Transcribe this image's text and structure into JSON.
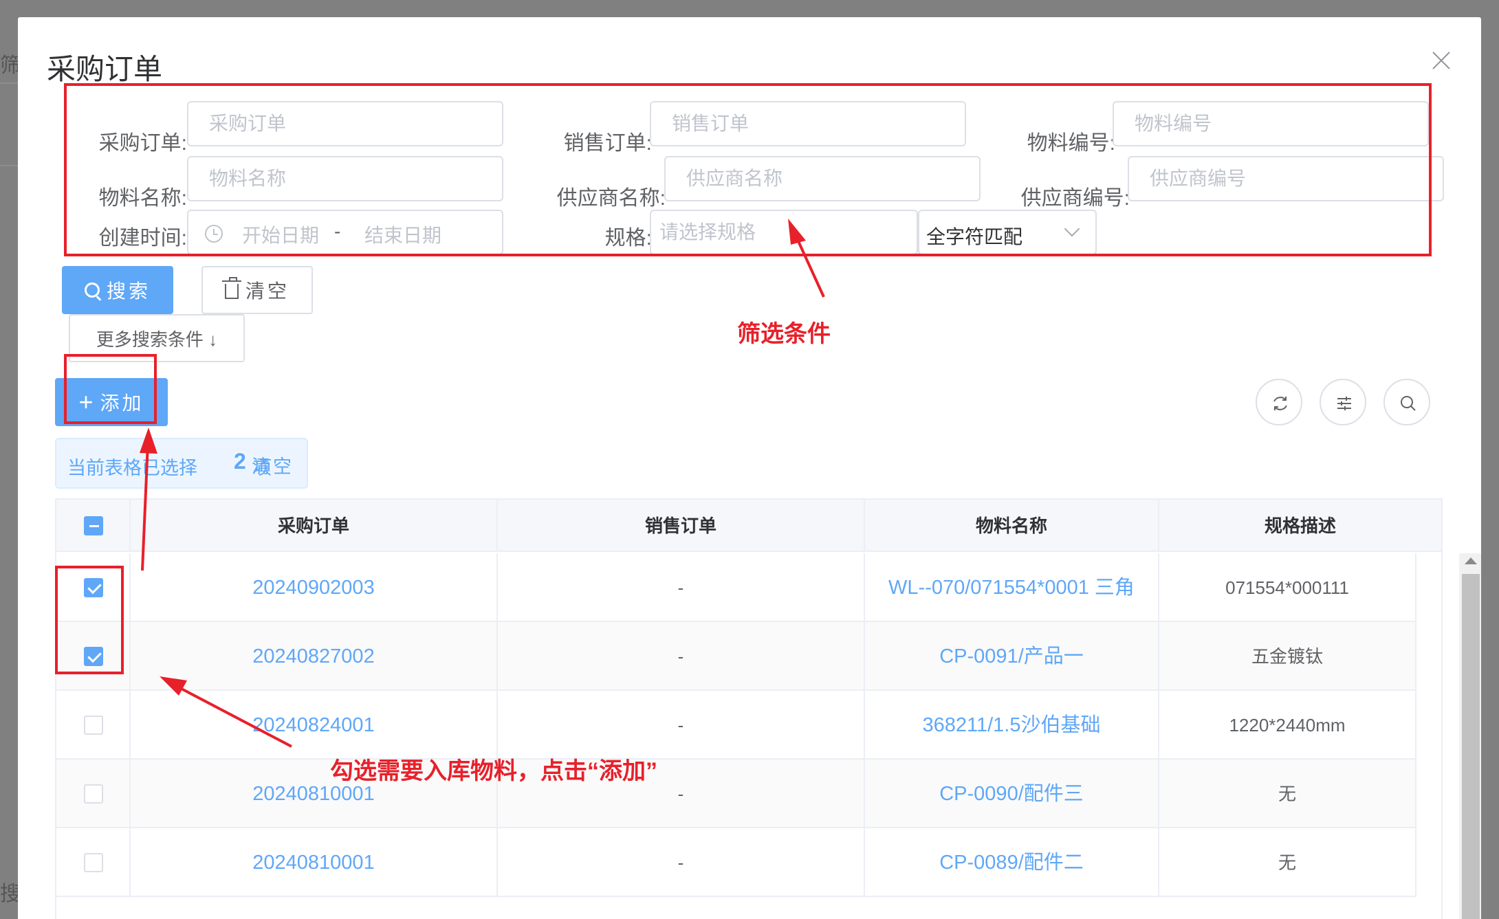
{
  "background": {
    "fragments": [
      "筛场",
      "搜"
    ]
  },
  "modal": {
    "title": "采购订单",
    "close_label": "×"
  },
  "filters": {
    "purchase_order": {
      "label": "采购订单:",
      "placeholder": "采购订单"
    },
    "sales_order": {
      "label": "销售订单:",
      "placeholder": "销售订单"
    },
    "material_code": {
      "label": "物料编号:",
      "placeholder": "物料编号"
    },
    "material_name": {
      "label": "物料名称:",
      "placeholder": "物料名称"
    },
    "supplier_name": {
      "label": "供应商名称:",
      "placeholder": "供应商名称"
    },
    "supplier_code": {
      "label": "供应商编号:",
      "placeholder": "供应商编号"
    },
    "created_time": {
      "label": "创建时间:",
      "start_placeholder": "开始日期",
      "separator": "-",
      "end_placeholder": "结束日期"
    },
    "spec": {
      "label": "规格:",
      "placeholder": "请选择规格",
      "match_mode": "全字符匹配"
    }
  },
  "buttons": {
    "search": "搜索",
    "clear": "清空",
    "more_conditions": "更多搜索条件 ↓",
    "add": "添加"
  },
  "selection": {
    "prefix": "当前表格已选择",
    "count": "2",
    "suffix": "项",
    "clear": "清空"
  },
  "table": {
    "columns": [
      "采购订单",
      "销售订单",
      "物料名称",
      "规格描述"
    ],
    "rows": [
      {
        "checked": true,
        "po": "20240902003",
        "so": "-",
        "material": "WL--070/071554*0001 三角",
        "spec": "071554*000111"
      },
      {
        "checked": true,
        "po": "20240827002",
        "so": "-",
        "material": "CP-0091/产品一",
        "spec": "五金镀钛"
      },
      {
        "checked": false,
        "po": "20240824001",
        "so": "-",
        "material": "368211/1.5沙伯基础",
        "spec": "1220*2440mm"
      },
      {
        "checked": false,
        "po": "20240810001",
        "so": "-",
        "material": "CP-0090/配件三",
        "spec": "无"
      },
      {
        "checked": false,
        "po": "20240810001",
        "so": "-",
        "material": "CP-0089/配件二",
        "spec": "无"
      }
    ]
  },
  "annotations": {
    "filter_label": "筛选条件",
    "select_label": "勾选需要入库物料，点击“添加”"
  },
  "colors": {
    "primary": "#5fa7f7",
    "annotation": "#e8202a"
  }
}
